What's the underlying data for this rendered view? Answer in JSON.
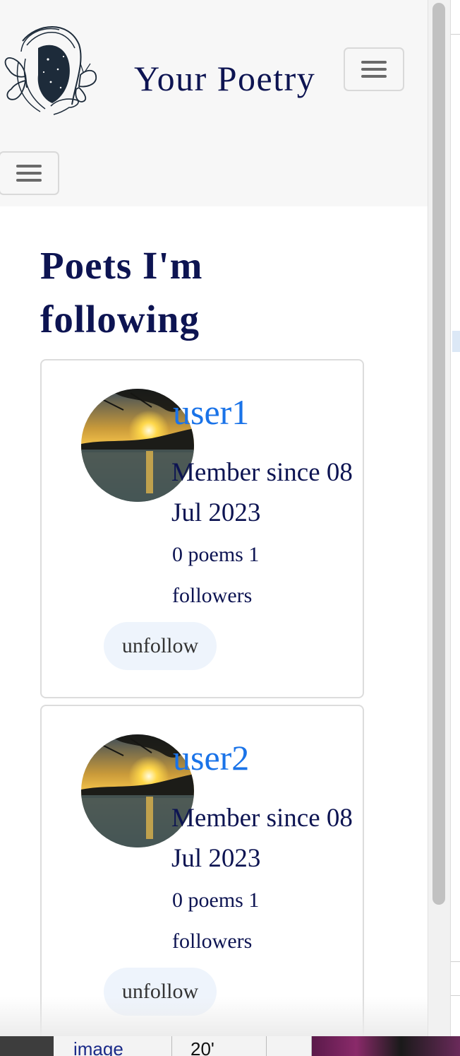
{
  "header": {
    "brand": "Your Poetry",
    "logo_icon": "butterfly-portrait-logo",
    "toggler_icon": "hamburger-icon"
  },
  "main": {
    "title": "Poets I'm following",
    "poets": [
      {
        "username": "user1",
        "member_since": "Member since 08 Jul 2023",
        "stats": "0 poems  1 followers",
        "button": "unfollow"
      },
      {
        "username": "user2",
        "member_since": "Member since 08 Jul 2023",
        "stats": "0 poems  1 followers",
        "button": "unfollow"
      }
    ]
  },
  "taskbar": {
    "cell_1": "image",
    "cell_2": "20'"
  },
  "colors": {
    "navy": "#0d1452",
    "link_blue": "#1a73e8",
    "navbar_bg": "#f7f7f7",
    "button_bg": "#eef4fc"
  }
}
